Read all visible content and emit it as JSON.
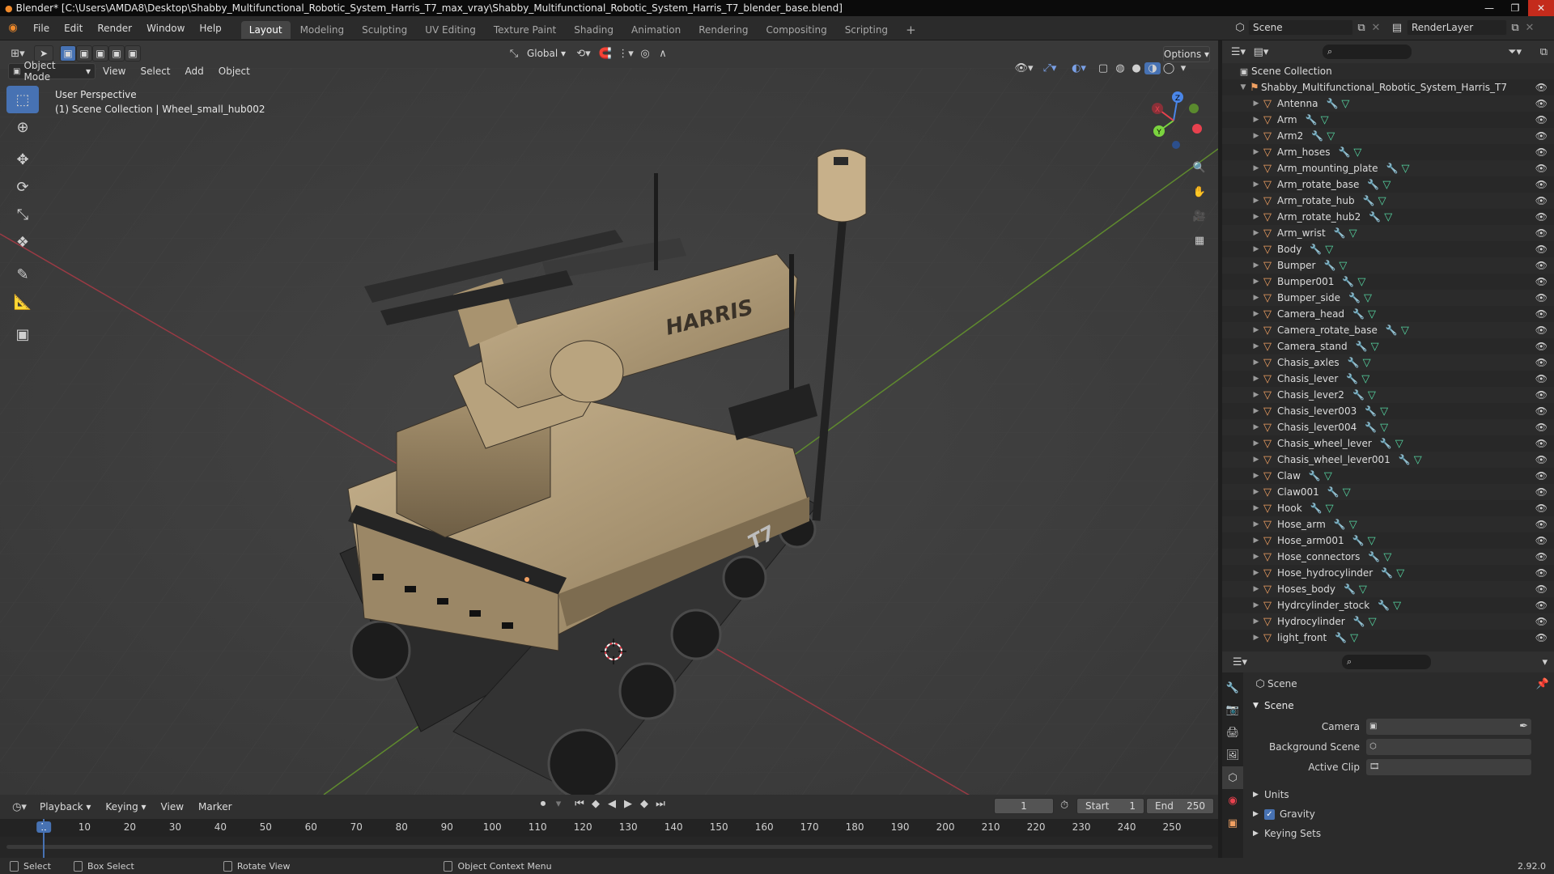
{
  "window": {
    "title": "Blender* [C:\\Users\\AMDA8\\Desktop\\Shabby_Multifunctional_Robotic_System_Harris_T7_max_vray\\Shabby_Multifunctional_Robotic_System_Harris_T7_blender_base.blend]"
  },
  "menu": [
    "File",
    "Edit",
    "Render",
    "Window",
    "Help"
  ],
  "workspaces": [
    {
      "label": "Layout",
      "active": true
    },
    {
      "label": "Modeling"
    },
    {
      "label": "Sculpting"
    },
    {
      "label": "UV Editing"
    },
    {
      "label": "Texture Paint"
    },
    {
      "label": "Shading"
    },
    {
      "label": "Animation"
    },
    {
      "label": "Rendering"
    },
    {
      "label": "Compositing"
    },
    {
      "label": "Scripting"
    }
  ],
  "scene_selector": {
    "value": "Scene"
  },
  "layer_selector": {
    "value": "RenderLayer"
  },
  "viewport": {
    "transform_orientation": "Global",
    "options_label": "Options",
    "mode": "Object Mode",
    "menus": [
      "View",
      "Select",
      "Add",
      "Object"
    ],
    "overlay_line1": "User Perspective",
    "overlay_line2": "(1) Scene Collection | Wheel_small_hub002",
    "model_brand": "HARRIS",
    "model_badge": "T7"
  },
  "outliner": {
    "root": "Scene Collection",
    "collection": "Shabby_Multifunctional_Robotic_System_Harris_T7",
    "items": [
      "Antenna",
      "Arm",
      "Arm2",
      "Arm_hoses",
      "Arm_mounting_plate",
      "Arm_rotate_base",
      "Arm_rotate_hub",
      "Arm_rotate_hub2",
      "Arm_wrist",
      "Body",
      "Bumper",
      "Bumper001",
      "Bumper_side",
      "Camera_head",
      "Camera_rotate_base",
      "Camera_stand",
      "Chasis_axles",
      "Chasis_lever",
      "Chasis_lever2",
      "Chasis_lever003",
      "Chasis_lever004",
      "Chasis_wheel_lever",
      "Chasis_wheel_lever001",
      "Claw",
      "Claw001",
      "Hook",
      "Hose_arm",
      "Hose_arm001",
      "Hose_connectors",
      "Hose_hydrocylinder",
      "Hoses_body",
      "Hydrcylinder_stock",
      "Hydrocylinder",
      "light_front"
    ]
  },
  "properties": {
    "breadcrumb": "Scene",
    "panel_title": "Scene",
    "fields": [
      {
        "label": "Camera",
        "value": ""
      },
      {
        "label": "Background Scene",
        "value": ""
      },
      {
        "label": "Active Clip",
        "value": ""
      }
    ],
    "sections": [
      "Units",
      "Gravity",
      "Keying Sets"
    ],
    "gravity_checked": true
  },
  "timeline": {
    "menus": [
      "Playback",
      "Keying",
      "View",
      "Marker"
    ],
    "current_frame": "1",
    "start_label": "Start",
    "start_value": "1",
    "end_label": "End",
    "end_value": "250",
    "ticks": [
      "1",
      "10",
      "20",
      "30",
      "40",
      "50",
      "60",
      "70",
      "80",
      "90",
      "100",
      "110",
      "120",
      "130",
      "140",
      "150",
      "160",
      "170",
      "180",
      "190",
      "200",
      "210",
      "220",
      "230",
      "240",
      "250"
    ]
  },
  "statusbar": {
    "items": [
      "Select",
      "Box Select",
      "Rotate View",
      "Object Context Menu"
    ],
    "version": "2.92.0"
  },
  "colors": {
    "accent": "#4772b3",
    "object_orange": "#f0a062",
    "mesh_green": "#56d6a2",
    "axis_x": "#e8414e",
    "axis_y": "#7bd43f",
    "axis_z": "#4a86e8"
  }
}
